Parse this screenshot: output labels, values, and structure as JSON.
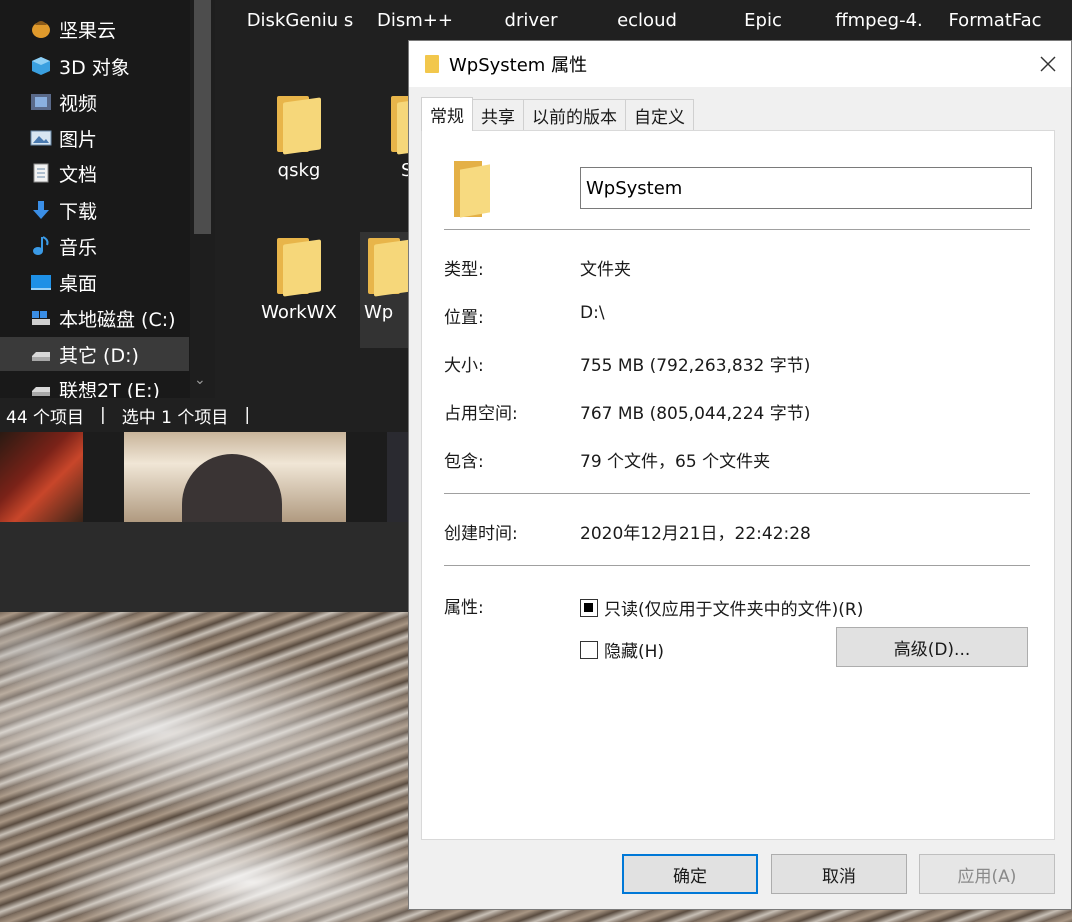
{
  "explorer": {
    "nav_items": [
      {
        "label": "坚果云",
        "icon": "jianguoyun-icon"
      },
      {
        "label": "3D 对象",
        "icon": "3d-objects-icon"
      },
      {
        "label": "视频",
        "icon": "videos-icon"
      },
      {
        "label": "图片",
        "icon": "pictures-icon"
      },
      {
        "label": "文档",
        "icon": "documents-icon"
      },
      {
        "label": "下载",
        "icon": "downloads-icon"
      },
      {
        "label": "音乐",
        "icon": "music-icon"
      },
      {
        "label": "桌面",
        "icon": "desktop-icon"
      },
      {
        "label": "本地磁盘 (C:)",
        "icon": "drive-icon"
      },
      {
        "label": "其它 (D:)",
        "icon": "drive-icon",
        "selected": true
      },
      {
        "label": "联想2T (E:)",
        "icon": "drive-icon"
      }
    ],
    "files_row1": [
      "DiskGeniu s",
      "Dism++",
      "driver",
      "ecloud",
      "Epic",
      "ffmpeg-4.",
      "FormatFac"
    ],
    "files": [
      {
        "label": "qskg"
      },
      {
        "label": "S"
      },
      {
        "label": "WorkWX"
      },
      {
        "label": "Wp"
      }
    ],
    "status": {
      "count": "44 个项目",
      "selected": "选中 1 个项目"
    }
  },
  "dialog": {
    "title": "WpSystem 属性",
    "tabs": [
      "常规",
      "共享",
      "以前的版本",
      "自定义"
    ],
    "active_tab": "常规",
    "folder_name": "WpSystem",
    "props": {
      "type_label": "类型:",
      "type_value": "文件夹",
      "location_label": "位置:",
      "location_value": "D:\\",
      "size_label": "大小:",
      "size_value": "755 MB (792,263,832 字节)",
      "disk_label": "占用空间:",
      "disk_value": "767 MB (805,044,224 字节)",
      "contains_label": "包含:",
      "contains_value": "79 个文件，65 个文件夹",
      "created_label": "创建时间:",
      "created_value": "2020年12月21日，22:42:28",
      "attr_label": "属性:",
      "readonly_label": "只读(仅应用于文件夹中的文件)(R)",
      "hidden_label": "隐藏(H)",
      "advanced_label": "高级(D)..."
    },
    "buttons": {
      "ok": "确定",
      "cancel": "取消",
      "apply": "应用(A)"
    }
  }
}
